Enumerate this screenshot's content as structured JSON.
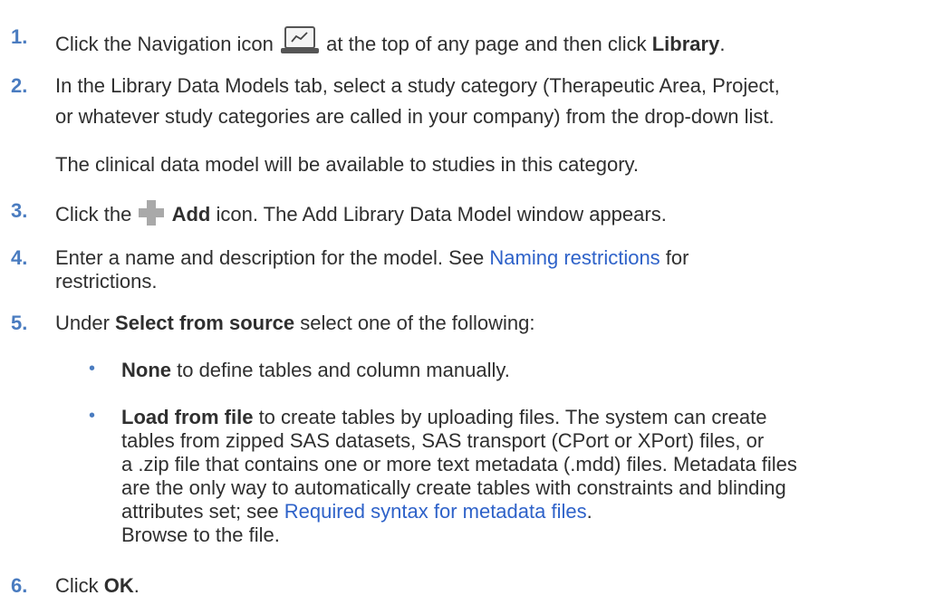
{
  "steps": [
    {
      "num": "1.",
      "pre": "Click the Navigation icon",
      "post": " at the top of any page and then click ",
      "bold": "Library",
      "end": "."
    },
    {
      "num": "2.",
      "line1": "In the Library Data Models tab, select a study category (Therapeutic Area, Project,",
      "line2": "or whatever study categories are called in your company) from the drop-down list.",
      "note": "The clinical data model will be available to studies in this category."
    },
    {
      "num": "3.",
      "pre": "Click the ",
      "bold": "Add",
      "post": " icon. The Add Library Data Model window appears."
    },
    {
      "num": "4.",
      "pre": "Enter a name and description for the model. See ",
      "link": "Naming restrictions",
      "post": " for",
      "line2": "restrictions."
    },
    {
      "num": "5.",
      "pre": "Under ",
      "bold": "Select from source",
      "post": " select one of the following:"
    },
    {
      "num": "6.",
      "pre": "Click ",
      "bold": "OK",
      "end": "."
    }
  ],
  "options": [
    {
      "bold": "None",
      "text": " to define tables and column manually."
    },
    {
      "bold": "Load from file",
      "text": " to create tables by uploading files. The system can create",
      "lines": [
        "tables from zipped SAS datasets, SAS transport (CPort or XPort) files, or",
        "a .zip file that contains one or more text metadata (.mdd) files. Metadata files",
        "are the only way to automatically create tables with constraints and blinding"
      ],
      "last_pre": "attributes set; see ",
      "link": "Required syntax for metadata files",
      "last_post": ".",
      "browse": "Browse to the file."
    }
  ],
  "bullet_char": "•",
  "icons": {
    "navigation": "navigation-laptop-icon",
    "add": "add-plus-icon"
  },
  "colors": {
    "step_number": "#4a7cc0",
    "link": "#2e62c9",
    "text": "#2f2f2f"
  }
}
